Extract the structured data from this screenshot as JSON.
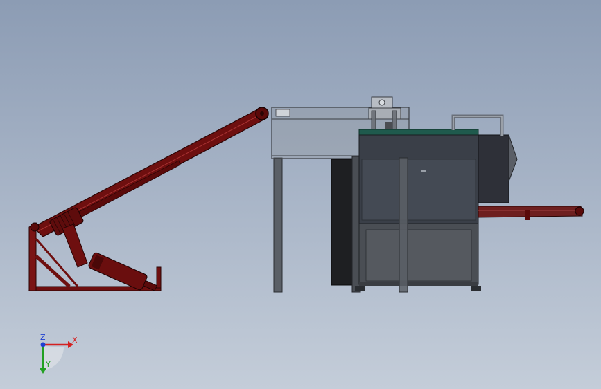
{
  "viewport": {
    "background_top": "#8c9cb4",
    "background_bottom": "#c4cdd9"
  },
  "model": {
    "conveyor_color": "#6e0f0f",
    "frame_color": "#555a60",
    "cabinet_color": "#3a3f48",
    "accent_color": "#1f5a4d"
  },
  "triad": {
    "x_label": "X",
    "y_label": "Y",
    "z_label": "Z",
    "x_color": "#d42020",
    "y_color": "#22a022",
    "z_color": "#2040d0"
  }
}
